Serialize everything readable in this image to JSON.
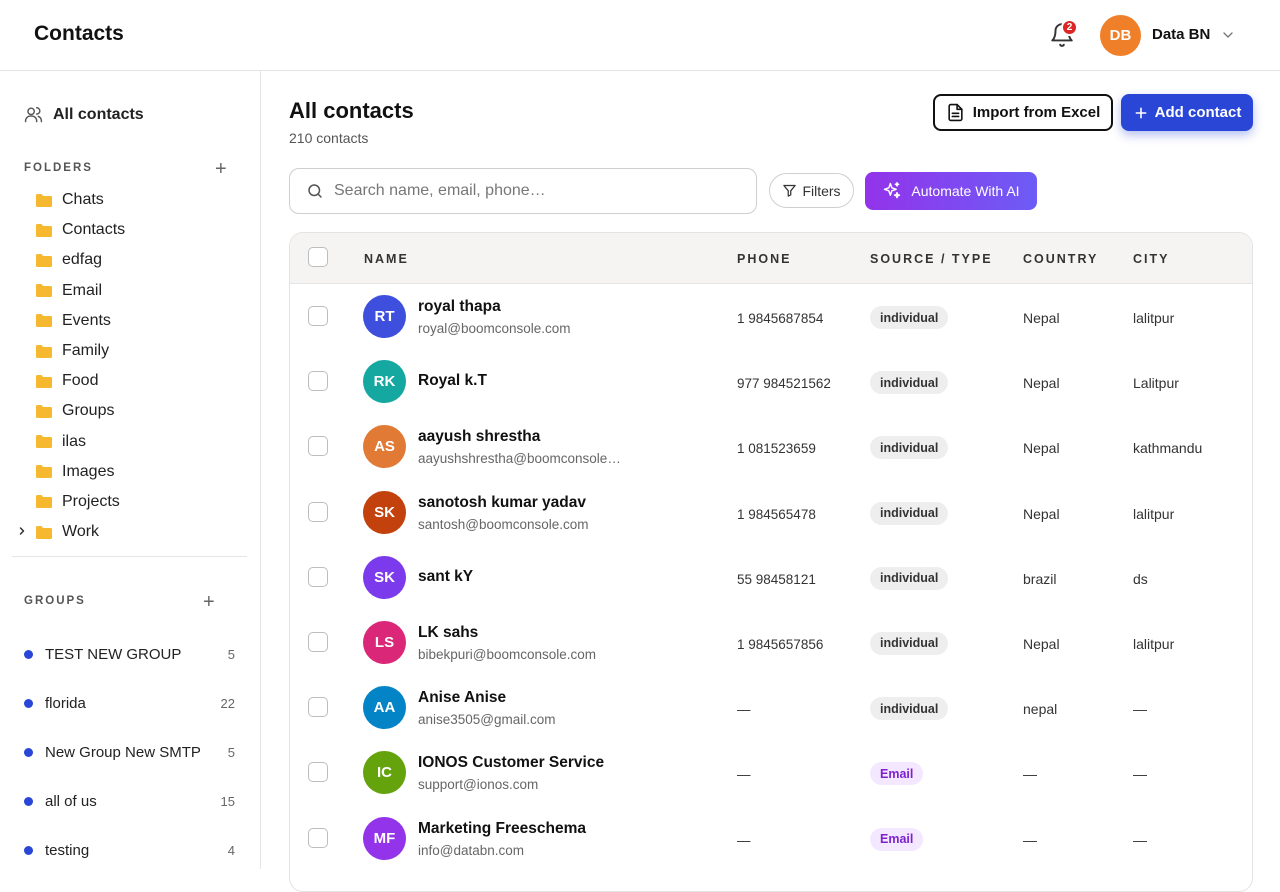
{
  "header": {
    "title": "Contacts",
    "notifications_count": "2",
    "user_initials": "DB",
    "user_name": "Data BN"
  },
  "sidebar": {
    "all_contacts_label": "All contacts",
    "folders_label": "FOLDERS",
    "folders": [
      "Chats",
      "Contacts",
      "edfag",
      "Email",
      "Events",
      "Family",
      "Food",
      "Groups",
      "ilas",
      "Images",
      "Projects",
      "Work"
    ],
    "groups_label": "GROUPS",
    "groups": [
      {
        "name": "TEST NEW GROUP",
        "count": "5"
      },
      {
        "name": "florida",
        "count": "22"
      },
      {
        "name": "New Group New SMTP",
        "count": "5"
      },
      {
        "name": "all of us",
        "count": "15"
      },
      {
        "name": "testing",
        "count": "4"
      }
    ]
  },
  "main": {
    "title": "All contacts",
    "subtitle": "210 contacts",
    "import_label": "Import from Excel",
    "add_label": "Add contact",
    "search_placeholder": "Search name, email, phone…",
    "filters_label": "Filters",
    "ai_label": "Automate With AI"
  },
  "table": {
    "columns": [
      "NAME",
      "PHONE",
      "SOURCE / TYPE",
      "COUNTRY",
      "CITY"
    ],
    "rows": [
      {
        "initials": "RT",
        "color": "#3d4fdc",
        "name": "royal thapa",
        "email": "royal@boomconsole.com",
        "phone": "1 9845687854",
        "type": "individual",
        "country": "Nepal",
        "city": "lalitpur"
      },
      {
        "initials": "RK",
        "color": "#14a8a0",
        "name": "Royal k.T",
        "email": "",
        "phone": "977 984521562",
        "type": "individual",
        "country": "Nepal",
        "city": "Lalitpur"
      },
      {
        "initials": "AS",
        "color": "#e07a35",
        "name": "aayush shrestha",
        "email": "aayushshrestha@boomconsole…",
        "phone": "1 081523659",
        "type": "individual",
        "country": "Nepal",
        "city": "kathmandu"
      },
      {
        "initials": "SK",
        "color": "#c2410c",
        "name": "sanotosh kumar yadav",
        "email": "santosh@boomconsole.com",
        "phone": "1 984565478",
        "type": "individual",
        "country": "Nepal",
        "city": "lalitpur"
      },
      {
        "initials": "SK",
        "color": "#7c3aed",
        "name": "sant kY",
        "email": "",
        "phone": "55 98458121",
        "type": "individual",
        "country": "brazil",
        "city": "ds"
      },
      {
        "initials": "LS",
        "color": "#db2777",
        "name": "LK sahs",
        "email": "bibekpuri@boomconsole.com",
        "phone": "1 9845657856",
        "type": "individual",
        "country": "Nepal",
        "city": "lalitpur"
      },
      {
        "initials": "AA",
        "color": "#0284c7",
        "name": "Anise Anise",
        "email": "anise3505@gmail.com",
        "phone": "—",
        "type": "individual",
        "country": "nepal",
        "city": "—"
      },
      {
        "initials": "IC",
        "color": "#65a30d",
        "name": "IONOS Customer Service",
        "email": "support@ionos.com",
        "phone": "—",
        "type": "Email",
        "country": "—",
        "city": "—"
      },
      {
        "initials": "MF",
        "color": "#9333ea",
        "name": "Marketing Freeschema",
        "email": "info@databn.com",
        "phone": "—",
        "type": "Email",
        "country": "—",
        "city": "—"
      }
    ]
  }
}
